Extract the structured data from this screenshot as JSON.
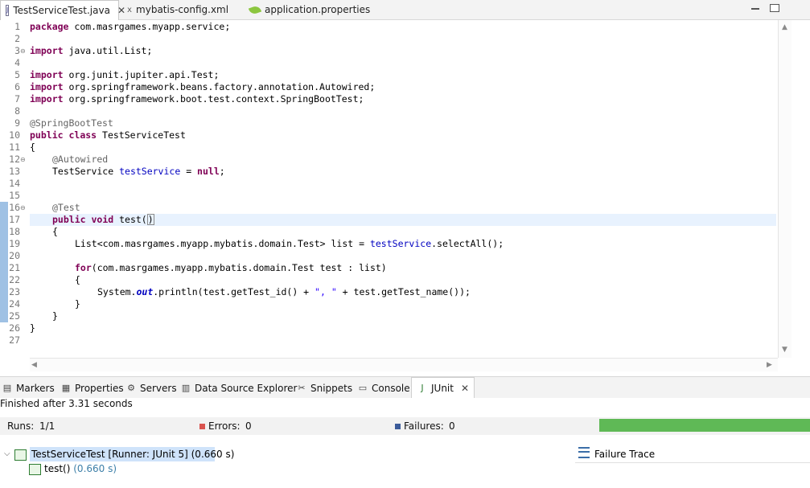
{
  "editor_tabs": [
    {
      "label": "TestServiceTest.java",
      "icon": "java-file-icon",
      "active": true
    },
    {
      "label": "mybatis-config.xml",
      "icon": "xml-file-icon",
      "active": false
    },
    {
      "label": "application.properties",
      "icon": "properties-file-icon",
      "active": false
    }
  ],
  "close_glyph": "✕",
  "line_numbers": [
    "1",
    "2",
    "3",
    "4",
    "5",
    "6",
    "7",
    "8",
    "9",
    "10",
    "11",
    "12",
    "13",
    "14",
    "15",
    "16",
    "17",
    "18",
    "19",
    "20",
    "21",
    "22",
    "23",
    "24",
    "25",
    "26",
    "27"
  ],
  "code": {
    "l1_kw": "package",
    "l1_rest": " com.masrgames.myapp.service;",
    "l3_kw": "import",
    "l3_rest": " java.util.List;",
    "l5_kw": "import",
    "l5_rest": " org.junit.jupiter.api.Test;",
    "l6_kw": "import",
    "l6_rest": " org.springframework.beans.factory.annotation.Autowired;",
    "l7_kw": "import",
    "l7_rest": " org.springframework.boot.test.context.SpringBootTest;",
    "l9_ann": "@SpringBootTest",
    "l10_kw1": "public",
    "l10_kw2": "class",
    "l10_rest": " TestServiceTest",
    "l11": "{",
    "l12_ann": "@Autowired",
    "l13_type": "TestService ",
    "l13_field": "testService",
    "l13_eq": " = ",
    "l13_null": "null",
    "l13_semi": ";",
    "l16_ann": "@Test",
    "l17_kw1": "public",
    "l17_kw2": "void",
    "l17_name": " test(",
    "l17_paren": ")",
    "l18": "{",
    "l19_a": "List<com.masrgames.myapp.mybatis.domain.Test> list = ",
    "l19_field": "testService",
    "l19_b": ".selectAll();",
    "l21_kw": "for",
    "l21_rest": "(com.masrgames.myapp.mybatis.domain.Test test : list)",
    "l22": "{",
    "l23_a": "System.",
    "l23_out": "out",
    "l23_b": ".println(test.getTest_id() + ",
    "l23_str": "\", \"",
    "l23_c": " + test.getTest_name());",
    "l24": "}",
    "l25": "}",
    "l26": "}"
  },
  "view_tabs": [
    {
      "label": "Markers",
      "icon": "markers-icon"
    },
    {
      "label": "Properties",
      "icon": "properties-icon"
    },
    {
      "label": "Servers",
      "icon": "servers-icon"
    },
    {
      "label": "Data Source Explorer",
      "icon": "data-source-explorer-icon"
    },
    {
      "label": "Snippets",
      "icon": "snippets-icon"
    },
    {
      "label": "Console",
      "icon": "console-icon"
    },
    {
      "label": "JUnit",
      "icon": "junit-icon",
      "active": true
    }
  ],
  "junit": {
    "status": "Finished after 3.31 seconds",
    "runs_label": "Runs:",
    "runs_value": "1/1",
    "errors_label": "Errors:",
    "errors_value": "0",
    "failures_label": "Failures:",
    "failures_value": "0",
    "progress_fraction": 1.0,
    "progress_color": "#5fb956",
    "tree_root_label": "TestServiceTest [Runner: JUnit 5]",
    "tree_root_time": "(0.660 s)",
    "tree_child_label": "test()",
    "tree_child_time": "(0.660 s)",
    "failure_trace_label": "Failure Trace"
  }
}
